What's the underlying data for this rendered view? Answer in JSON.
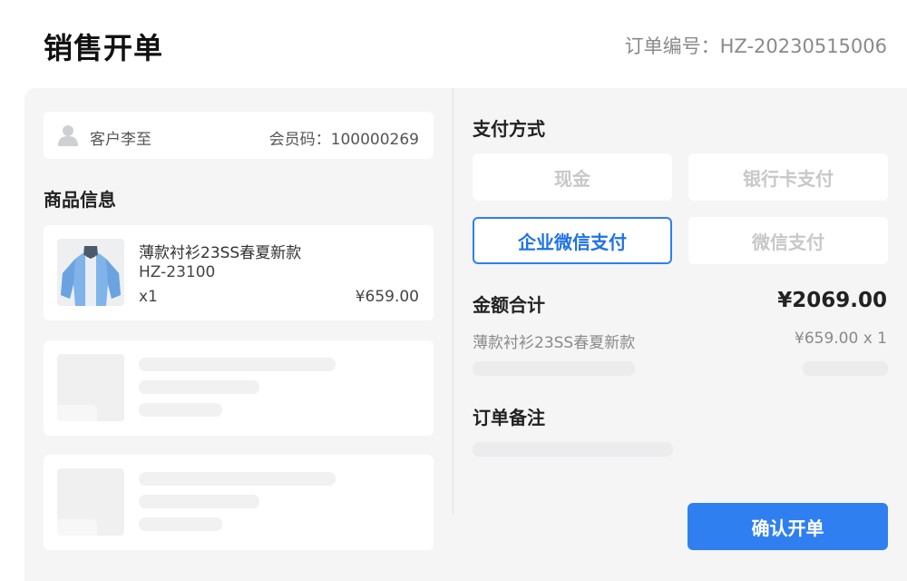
{
  "header": {
    "title": "销售开单",
    "order_no": "订单编号：HZ-20230515006"
  },
  "customer": {
    "name": "客户李至",
    "member": "会员码：100000269"
  },
  "products": {
    "section_title": "商品信息",
    "items": [
      {
        "name": "薄款衬衫23SS春夏新款",
        "code": "HZ-23100",
        "qty": "x1",
        "price": "¥659.00"
      }
    ]
  },
  "payment": {
    "section_title": "支付方式",
    "methods": [
      "现金",
      "银行卡支付",
      "企业微信支付",
      "微信支付"
    ],
    "selected": "企业微信支付"
  },
  "summary": {
    "total_label": "金额合计",
    "total_value": "¥2069.00",
    "lines": [
      {
        "name": "薄款衬衫23SS春夏新款",
        "price": "¥659.00 x 1"
      }
    ]
  },
  "remark": {
    "section_title": "订单备注"
  },
  "actions": {
    "confirm_label": "确认开单"
  },
  "colors": {
    "accent": "#2f7ff0",
    "panel_bg": "#f5f5f6"
  }
}
